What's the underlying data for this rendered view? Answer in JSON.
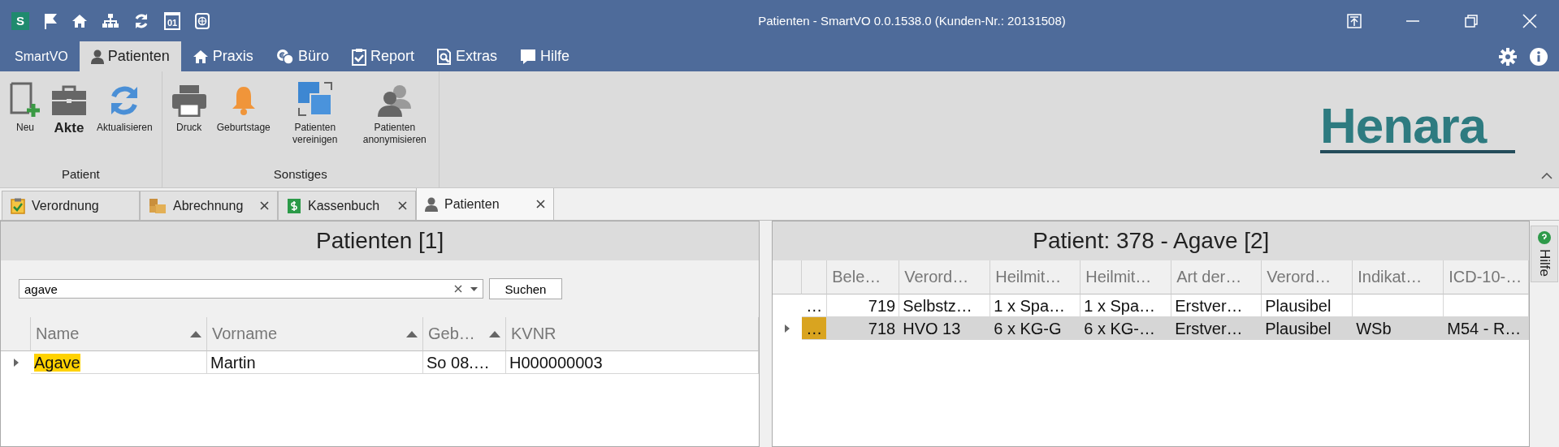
{
  "title_bar": {
    "app_badge": "S",
    "calendar_day": "01",
    "title": "Patienten - SmartVO 0.0.1538.0 (Kunden-Nr.: 20131508)"
  },
  "menu_tabs": [
    {
      "label": "SmartVO",
      "selected": false
    },
    {
      "label": "Patienten",
      "selected": true
    },
    {
      "label": "Praxis",
      "selected": false
    },
    {
      "label": "Büro",
      "selected": false
    },
    {
      "label": "Report",
      "selected": false
    },
    {
      "label": "Extras",
      "selected": false
    },
    {
      "label": "Hilfe",
      "selected": false
    }
  ],
  "ribbon": {
    "groups": [
      {
        "label": "Patient",
        "buttons": [
          {
            "label": "Neu",
            "emphasized": false
          },
          {
            "label": "Akte",
            "emphasized": true
          },
          {
            "label": "Aktualisieren",
            "emphasized": false
          }
        ]
      },
      {
        "label": "Sonstiges",
        "buttons": [
          {
            "label": "Druck",
            "emphasized": false
          },
          {
            "label": "Geburtstage",
            "emphasized": false
          },
          {
            "label": "Patienten vereinigen",
            "emphasized": false
          },
          {
            "label": "Patienten anonymisieren",
            "emphasized": false
          }
        ]
      }
    ],
    "logo": {
      "part_1": "Hen",
      "part_2": "ara"
    }
  },
  "doc_tabs": [
    {
      "label": "Verordnung",
      "closable": false,
      "selected": false
    },
    {
      "label": "Abrechnung",
      "closable": true,
      "selected": false
    },
    {
      "label": "Kassenbuch",
      "closable": true,
      "selected": false
    },
    {
      "label": "Patienten",
      "closable": true,
      "selected": true
    }
  ],
  "left_panel": {
    "title": "Patienten [1]",
    "search": {
      "value": "agave",
      "button": "Suchen"
    },
    "columns": [
      {
        "label": "Name",
        "sorted": true
      },
      {
        "label": "Vorname",
        "sorted": true
      },
      {
        "label": "Geb…",
        "sorted": true
      },
      {
        "label": "KVNR",
        "sorted": false
      }
    ],
    "rows": [
      {
        "current": true,
        "cells": [
          {
            "text": "Agave",
            "highlighted": true
          },
          {
            "text": "Martin",
            "highlighted": false
          },
          {
            "text": "So 08.…",
            "highlighted": false
          },
          {
            "text": "H000000003",
            "highlighted": false
          }
        ]
      }
    ]
  },
  "right_panel": {
    "title": "Patient: 378 - Agave [2]",
    "columns": [
      "Bele…",
      "Verord…",
      "Heilmit…",
      "Heilmit…",
      "Art der…",
      "Verord…",
      "Indikat…",
      "ICD-10-…"
    ],
    "rows": [
      {
        "current": false,
        "selected": false,
        "marker": "…",
        "cells": [
          "719",
          "Selbstz…",
          "1 x Spa…",
          "1 x Spa…",
          "Erstver…",
          "Plausibel",
          null,
          null
        ]
      },
      {
        "current": true,
        "selected": true,
        "marker": "…",
        "color": "#d9a420",
        "cells": [
          "718",
          "HVO 13",
          "6 x KG-G",
          "6 x KG-…",
          "Erstver…",
          "Plausibel",
          "WSb",
          "M54 - R…"
        ]
      }
    ]
  },
  "side_panel": {
    "label": "Hilfe"
  }
}
